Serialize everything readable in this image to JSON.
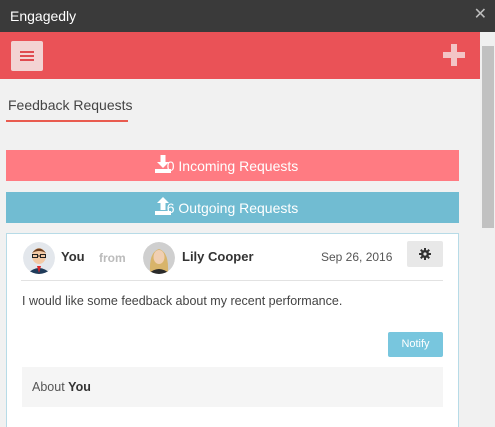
{
  "window": {
    "title": "Engagedly",
    "close_glyph": "✕"
  },
  "colors": {
    "toolbar": "#ea5257",
    "incoming": "#ff7b82",
    "outgoing": "#71bcd2",
    "tab_underline": "#e95b4f",
    "notify": "#78c6de"
  },
  "toolbar": {
    "menu_icon": "hamburger-menu-icon",
    "add_icon": "plus-icon"
  },
  "tabs": [
    {
      "label": "Feedback Requests",
      "active": true
    }
  ],
  "requests": {
    "incoming_label": "0 Incoming Requests",
    "incoming_icon": "download-icon",
    "outgoing_label": "6 Outgoing Requests",
    "outgoing_icon": "upload-icon"
  },
  "feedback_card": {
    "requester": "You",
    "from_label": "from",
    "recipient": "Lily Cooper",
    "date": "Sep 26, 2016",
    "settings_icon": "gear-icon",
    "message": "I would like some feedback about my recent performance.",
    "notify_label": "Notify",
    "about_prefix": "About",
    "about_name": "You"
  }
}
